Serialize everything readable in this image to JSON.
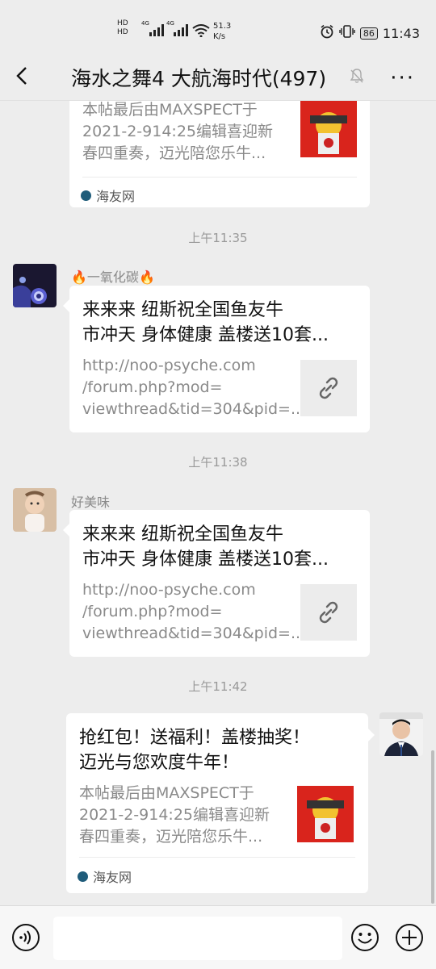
{
  "status": {
    "hd1": "HD",
    "hd2": "HD",
    "net1": "4G",
    "net2": "4G",
    "speed_value": "51.3",
    "speed_unit": "K/s",
    "battery": "86",
    "time": "11:43"
  },
  "header": {
    "title": "海水之舞4 大航海时代(497)",
    "more": "···"
  },
  "messages": {
    "m0": {
      "desc": [
        "本帖最后由MAXSPECT于",
        "2021-2-914:25编辑喜迎新",
        "春四重奏，迈光陪您乐牛..."
      ],
      "source": "海友网"
    },
    "t1": "上午11:35",
    "m1": {
      "sender": "一氧化碳",
      "title": [
        "来来来 纽斯祝全国鱼友牛",
        "市冲天 身体健康 盖楼送10套..."
      ],
      "desc": [
        "http://noo-psyche.com",
        "/forum.php?mod=",
        "viewthread&tid=304&pid=..."
      ]
    },
    "t2": "上午11:38",
    "m2": {
      "sender": "好美味",
      "title": [
        "来来来 纽斯祝全国鱼友牛",
        "市冲天 身体健康 盖楼送10套..."
      ],
      "desc": [
        "http://noo-psyche.com",
        "/forum.php?mod=",
        "viewthread&tid=304&pid=..."
      ]
    },
    "t3": "上午11:42",
    "m3": {
      "title": [
        "抢红包！送福利！盖楼抽奖！",
        "迈光与您欢度牛年！"
      ],
      "desc": [
        "本帖最后由MAXSPECT于",
        "2021-2-914:25编辑喜迎新",
        "春四重奏，迈光陪您乐牛..."
      ],
      "source": "海友网"
    }
  },
  "input": {
    "placeholder": ""
  },
  "icons": {
    "back": "back-arrow-icon",
    "mute": "bell-off-icon",
    "voice": "voice-icon",
    "emoji": "emoji-icon",
    "plus": "plus-icon",
    "link": "link-icon"
  }
}
